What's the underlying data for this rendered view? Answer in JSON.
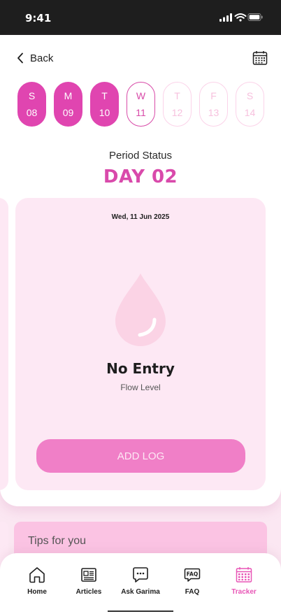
{
  "status_bar": {
    "time": "9:41"
  },
  "header": {
    "back_label": "Back"
  },
  "week": [
    {
      "letter": "S",
      "num": "08",
      "state": "past"
    },
    {
      "letter": "M",
      "num": "09",
      "state": "past"
    },
    {
      "letter": "T",
      "num": "10",
      "state": "past"
    },
    {
      "letter": "W",
      "num": "11",
      "state": "today"
    },
    {
      "letter": "T",
      "num": "12",
      "state": "future"
    },
    {
      "letter": "F",
      "num": "13",
      "state": "future"
    },
    {
      "letter": "S",
      "num": "14",
      "state": "future"
    }
  ],
  "period": {
    "label": "Period Status",
    "day": "DAY 02"
  },
  "entry": {
    "date": "Wed, 11 Jun 2025",
    "title": "No Entry",
    "subtitle": "Flow Level",
    "button": "ADD LOG"
  },
  "tips": {
    "title": "Tips for you"
  },
  "nav": [
    {
      "label": "Home",
      "icon": "home-icon",
      "active": false
    },
    {
      "label": "Articles",
      "icon": "articles-icon",
      "active": false
    },
    {
      "label": "Ask Garima",
      "icon": "chat-icon",
      "active": false
    },
    {
      "label": "FAQ",
      "icon": "faq-icon",
      "active": false
    },
    {
      "label": "Tracker",
      "icon": "tracker-icon",
      "active": true
    }
  ],
  "colors": {
    "accent": "#e045b0",
    "accent_light": "#fde8f4",
    "button": "#f07fc7",
    "tips_bg": "#fbc3e3",
    "nav_active": "#e855b6"
  }
}
